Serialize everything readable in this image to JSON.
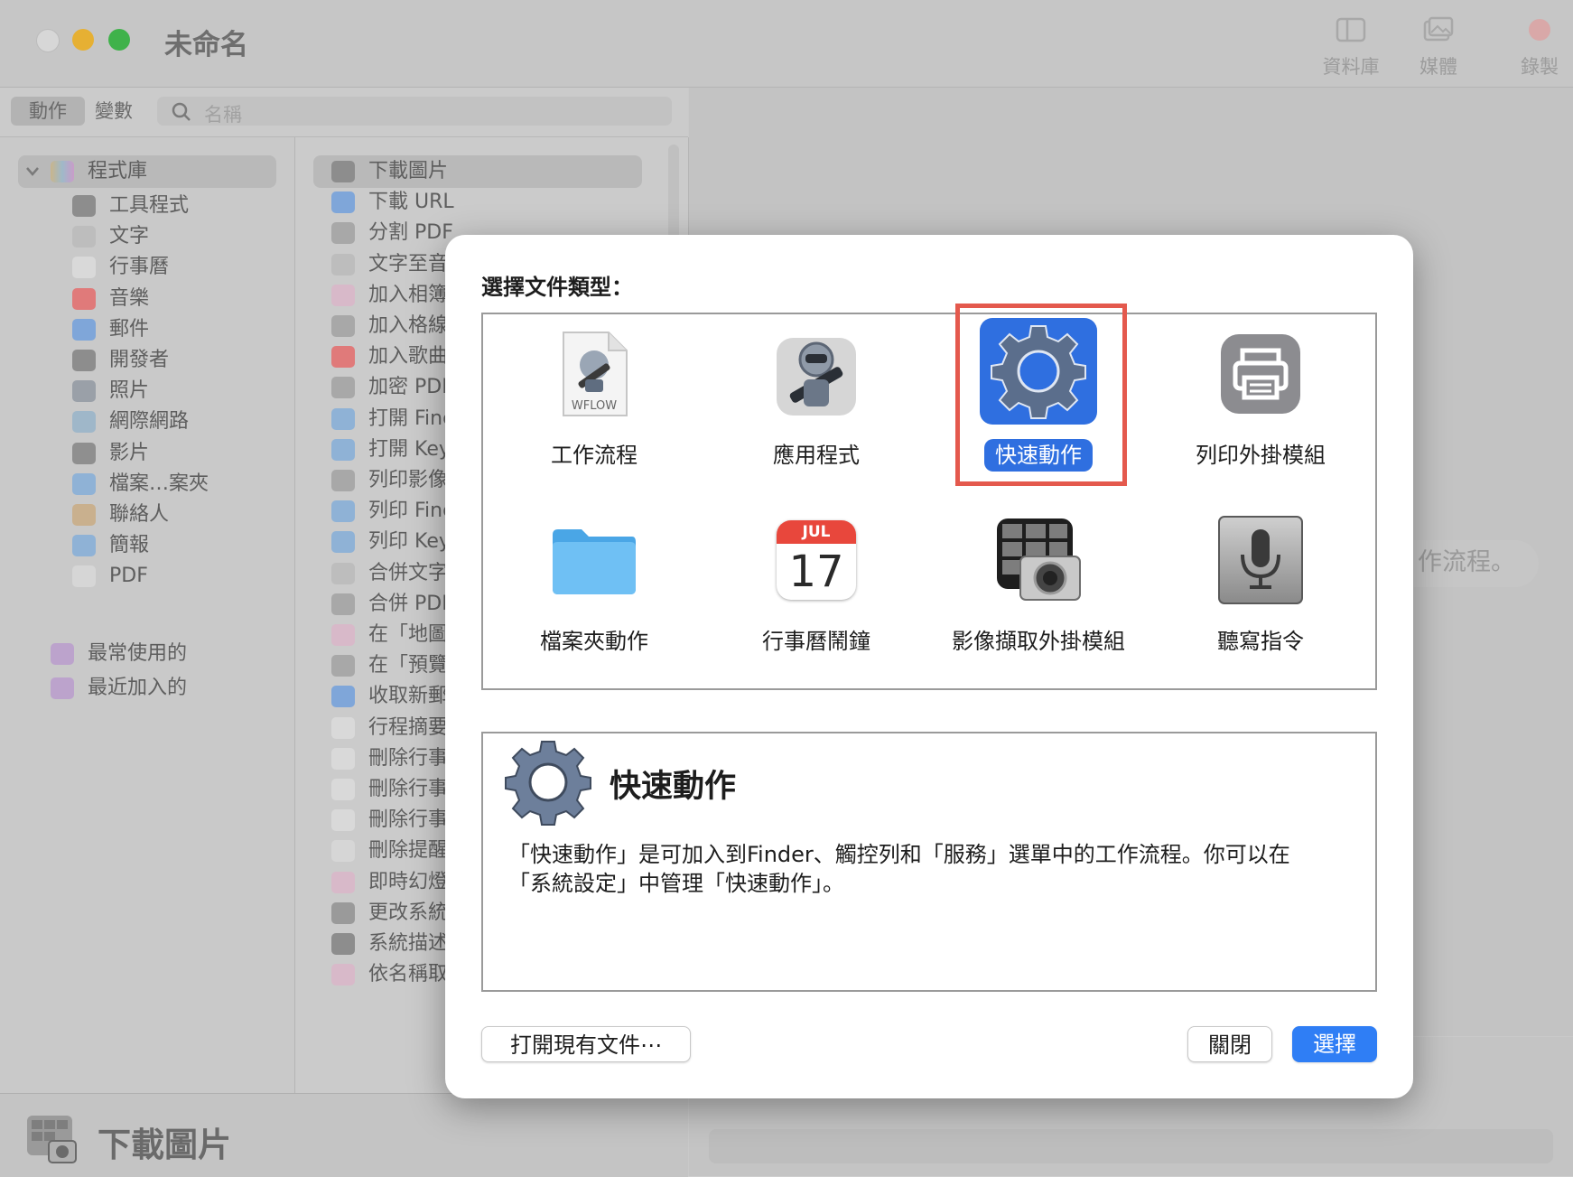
{
  "window": {
    "title": "未命名"
  },
  "toolbar": {
    "library": "資料庫",
    "media": "媒體",
    "record": "錄製"
  },
  "tabs": {
    "actions": "動作",
    "variables": "變數"
  },
  "search": {
    "placeholder": "名稱"
  },
  "library": {
    "root": "程式庫",
    "items": [
      "工具程式",
      "文字",
      "行事曆",
      "音樂",
      "郵件",
      "開發者",
      "照片",
      "網際網路",
      "影片",
      "檔案…案夾",
      "聯絡人",
      "簡報",
      "PDF"
    ],
    "favorites": "最常使用的",
    "recent": "最近加入的"
  },
  "actions_list": [
    "下載圖片",
    "下載 URL",
    "分割 PDF",
    "文字至音",
    "加入相簿",
    "加入格線",
    "加入歌曲",
    "加密 PDF",
    "打開 Finc",
    "打開 Key",
    "列印影像",
    "列印 Finc",
    "列印 Key",
    "合併文字",
    "合併 PDF",
    "在「地圖",
    "在「預覽",
    "收取新郵",
    "行程摘要",
    "刪除行事",
    "刪除行事",
    "刪除行事",
    "刪除提醒",
    "即時幻燈",
    "更改系統",
    "系統描述",
    "依名稱取"
  ],
  "right_hint": "作流程。",
  "bottom": {
    "title": "下載圖片"
  },
  "modal": {
    "heading": "選擇文件類型：",
    "types": [
      {
        "label": "工作流程",
        "badge": "WFLOW",
        "icon": "workflow-doc-icon"
      },
      {
        "label": "應用程式",
        "icon": "automator-robot-icon"
      },
      {
        "label": "快速動作",
        "icon": "gear-icon",
        "selected": true
      },
      {
        "label": "列印外掛模組",
        "icon": "printer-icon"
      },
      {
        "label": "檔案夾動作",
        "icon": "folder-icon"
      },
      {
        "label": "行事曆鬧鐘",
        "cal_month": "JUL",
        "cal_day": "17",
        "icon": "calendar-icon"
      },
      {
        "label": "影像擷取外掛模組",
        "icon": "image-capture-icon"
      },
      {
        "label": "聽寫指令",
        "icon": "microphone-icon"
      }
    ],
    "description": {
      "title": "快速動作",
      "text_line1": "「快速動作」是可加入到Finder、觸控列和「服務」選單中的工作流程。你可以在",
      "text_line2": "「系統設定」中管理「快速動作」。"
    },
    "buttons": {
      "open_existing": "打開現有文件⋯",
      "close": "關閉",
      "choose": "選擇"
    }
  },
  "colors": {
    "accent": "#2f7ef5",
    "highlight_border": "#e4594d"
  }
}
